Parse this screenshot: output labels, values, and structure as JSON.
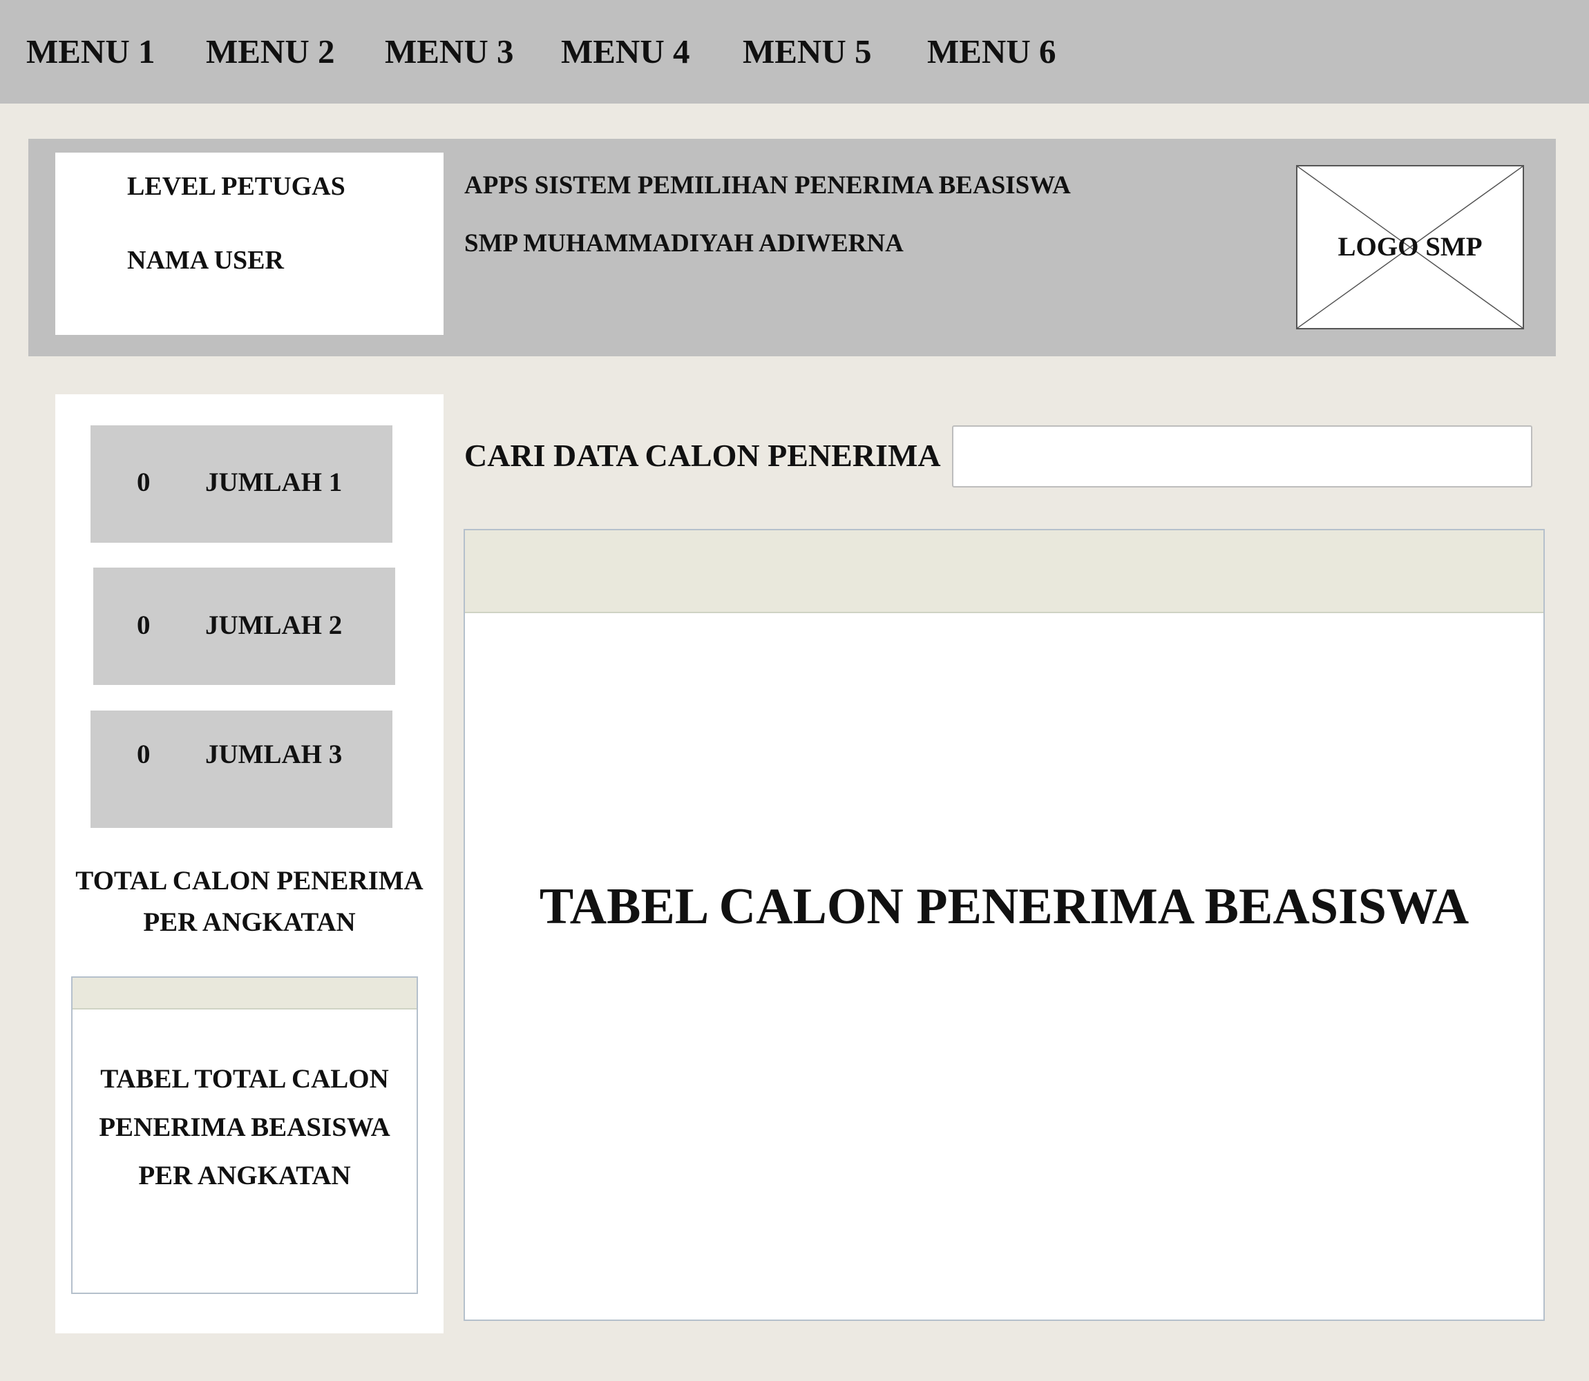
{
  "menu": {
    "items": [
      {
        "label": "MENU 1"
      },
      {
        "label": "MENU 2"
      },
      {
        "label": "MENU 3"
      },
      {
        "label": "MENU 4"
      },
      {
        "label": "MENU 5"
      },
      {
        "label": "MENU 6"
      }
    ]
  },
  "header": {
    "user_level": "LEVEL PETUGAS",
    "user_name": "NAMA USER",
    "app_title": "APPS SISTEM PEMILIHAN PENERIMA BEASISWA",
    "school_name": "SMP MUHAMMADIYAH ADIWERNA",
    "logo_label": "LOGO SMP"
  },
  "sidebar": {
    "stats": [
      {
        "value": "0",
        "label": "JUMLAH 1"
      },
      {
        "value": "0",
        "label": "JUMLAH 2"
      },
      {
        "value": "0",
        "label": "JUMLAH 3"
      }
    ],
    "total_heading_line1": "TOTAL CALON PENERIMA",
    "total_heading_line2": "PER ANGKATAN",
    "mini_table_line1": "TABEL TOTAL CALON",
    "mini_table_line2": "PENERIMA BEASISWA",
    "mini_table_line3": "PER ANGKATAN"
  },
  "main": {
    "search_label": "CARI DATA CALON PENERIMA",
    "search_value": "",
    "table_label": "TABEL CALON PENERIMA BEASISWA"
  }
}
